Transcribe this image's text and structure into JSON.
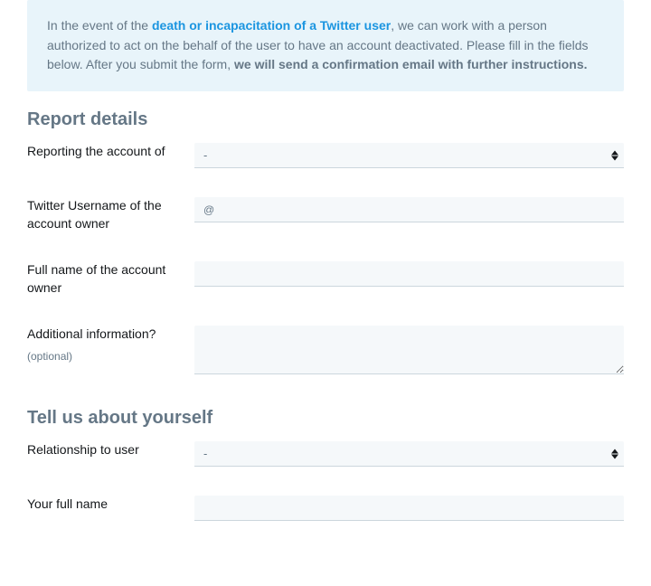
{
  "notice": {
    "pre": "In the event of the ",
    "link": "death or incapacitation of a Twitter user",
    "post": ", we can work with a person authorized to act on the behalf of the user to have an account deactivated. Please fill in the fields below. After you submit the form, ",
    "bold": "we will send a confirmation email with further instructions."
  },
  "section1": {
    "title": "Report details",
    "fields": {
      "reporting_account": {
        "label": "Reporting the account of",
        "selected": "-"
      },
      "username": {
        "label": "Twitter Username of the account owner",
        "prefix": "@",
        "value": ""
      },
      "fullname": {
        "label": "Full name of the account owner",
        "value": ""
      },
      "additional": {
        "label": "Additional information?",
        "optional": "(optional)",
        "value": ""
      }
    }
  },
  "section2": {
    "title": "Tell us about yourself",
    "fields": {
      "relationship": {
        "label": "Relationship to user",
        "selected": "-"
      },
      "your_fullname": {
        "label": "Your full name",
        "value": ""
      }
    }
  }
}
